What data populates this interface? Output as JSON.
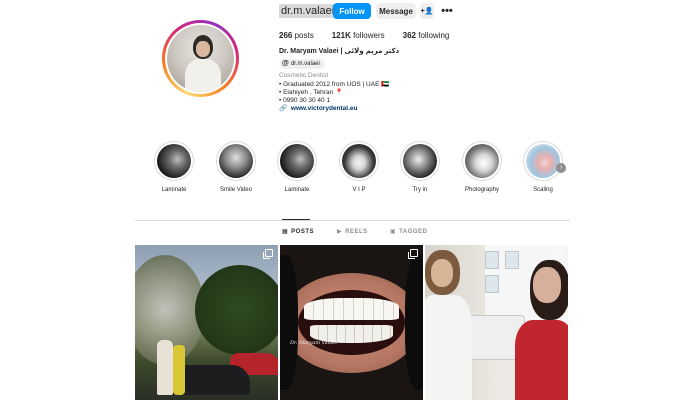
{
  "profile": {
    "username": "dr.m.valaei",
    "follow_label": "Follow",
    "message_label": "Message",
    "add_user_icon": "add-user-icon",
    "more_icon": "more-icon",
    "stats": {
      "posts_count": "266",
      "posts_label": "posts",
      "followers_count": "121K",
      "followers_label": "followers",
      "following_count": "362",
      "following_label": "following"
    },
    "full_name": "Dr. Maryam Valaei | دکتر مریم ولائی",
    "threads_handle": "dr.m.valaei",
    "category": "Cosmetic Dentist",
    "bio_lines": [
      "• Graduated 2012 from UOS | UAE 🇦🇪",
      "• Elahiyeh , Tehran 📍",
      "• 0990 30 30 40 1"
    ],
    "website": "www.victorydental.eu"
  },
  "highlights": [
    {
      "label": "Laminate"
    },
    {
      "label": "Smile Video"
    },
    {
      "label": "Laminate"
    },
    {
      "label": "V I P"
    },
    {
      "label": "Try in"
    },
    {
      "label": "Photography"
    },
    {
      "label": "Scaling"
    }
  ],
  "tabs": [
    {
      "label": "POSTS",
      "icon": "grid-icon",
      "active": true
    },
    {
      "label": "REELS",
      "icon": "reels-icon",
      "active": false
    },
    {
      "label": "TAGGED",
      "icon": "tagged-icon",
      "active": false
    }
  ],
  "posts": [
    {
      "type": "carousel"
    },
    {
      "type": "carousel",
      "caption_signature": "Dr. Maryam Valaei"
    },
    {
      "type": "reel"
    }
  ],
  "colors": {
    "follow_button": "#0095f6",
    "secondary_button": "#efefef",
    "link": "#00376b",
    "muted_text": "#8e8e8e"
  }
}
